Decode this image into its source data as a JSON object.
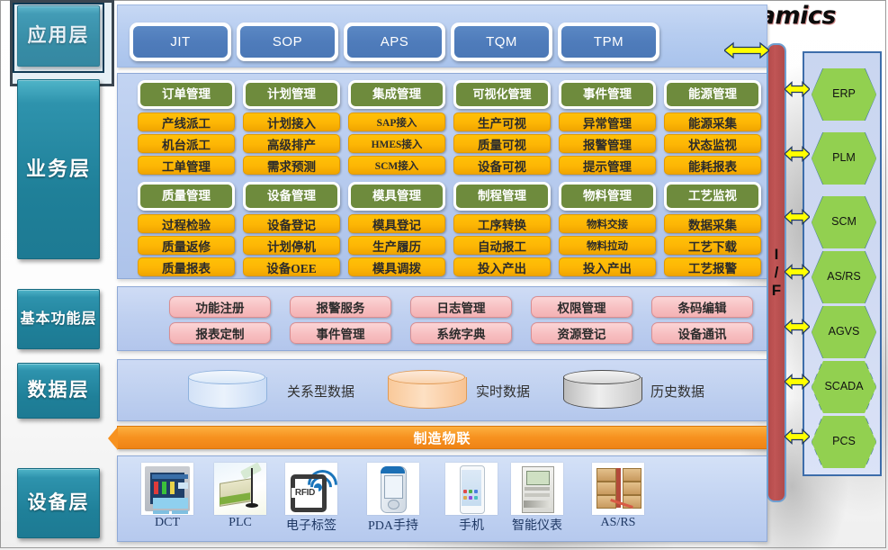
{
  "title": "Dynamics",
  "layers": [
    {
      "id": "application",
      "label": "应用层",
      "selected": true
    },
    {
      "id": "business",
      "label": "业务层",
      "selected": false
    },
    {
      "id": "basic-function",
      "label": "基本\n功能层",
      "label_line1": "基本",
      "label_line2": "功能层",
      "selected": false
    },
    {
      "id": "data",
      "label": "数据层",
      "selected": false
    },
    {
      "id": "device",
      "label": "设备层",
      "selected": false
    }
  ],
  "application_layer": {
    "chips": [
      "JIT",
      "SOP",
      "APS",
      "TQM",
      "TPM"
    ]
  },
  "business_layer": {
    "columns": [
      {
        "groups": [
          {
            "head": "订单管理",
            "items": [
              "产线派工",
              "机台派工",
              "工单管理"
            ]
          },
          {
            "head": "质量管理",
            "items": [
              "过程检验",
              "质量返修",
              "质量报表"
            ]
          }
        ]
      },
      {
        "groups": [
          {
            "head": "计划管理",
            "items": [
              "计划接入",
              "高级排产",
              "需求预测"
            ]
          },
          {
            "head": "设备管理",
            "items": [
              "设备登记",
              "计划停机",
              "设备OEE"
            ]
          }
        ]
      },
      {
        "groups": [
          {
            "head": "集成管理",
            "items": [
              "SAP接入",
              "HMES接入",
              "SCM接入"
            ]
          },
          {
            "head": "模具管理",
            "items": [
              "模具登记",
              "生产履历",
              "模具调拨"
            ]
          }
        ]
      },
      {
        "groups": [
          {
            "head": "可视化管理",
            "items": [
              "生产可视",
              "质量可视",
              "设备可视"
            ]
          },
          {
            "head": "制程管理",
            "items": [
              "工序转换",
              "自动报工",
              "投入产出"
            ]
          }
        ]
      },
      {
        "groups": [
          {
            "head": "事件管理",
            "items": [
              "异常管理",
              "报警管理",
              "提示管理"
            ]
          },
          {
            "head": "物料管理",
            "items": [
              "物料交接",
              "物料拉动",
              "投入产出"
            ]
          }
        ]
      },
      {
        "groups": [
          {
            "head": "能源管理",
            "items": [
              "能源采集",
              "状态监视",
              "能耗报表"
            ]
          },
          {
            "head": "工艺监视",
            "items": [
              "数据采集",
              "工艺下载",
              "工艺报警"
            ]
          }
        ]
      }
    ]
  },
  "basic_function_layer": {
    "row1": [
      "功能注册",
      "报警服务",
      "日志管理",
      "权限管理",
      "条码编辑"
    ],
    "row2": [
      "报表定制",
      "事件管理",
      "系统字典",
      "资源登记",
      "设备通讯"
    ]
  },
  "data_layer": {
    "stores": [
      {
        "label": "关系型数据",
        "color": "#dae8f8",
        "style": "blue"
      },
      {
        "label": "实时数据",
        "color": "#f9d3ae",
        "style": "orange"
      },
      {
        "label": "历史数据",
        "color": "#d8d8d8",
        "style": "grey"
      }
    ]
  },
  "iot_bar": {
    "label": "制造物联",
    "color": "#f79220"
  },
  "device_layer": {
    "devices": [
      {
        "label": "DCT",
        "icon": "hmi-panel-icon"
      },
      {
        "label": "PLC",
        "icon": "plc-module-icon"
      },
      {
        "label": "电子标签",
        "icon": "rfid-tag-icon"
      },
      {
        "label": "PDA手持",
        "icon": "pda-handheld-icon"
      },
      {
        "label": "手机",
        "icon": "mobile-phone-icon"
      },
      {
        "label": "智能仪表",
        "icon": "smart-meter-icon"
      },
      {
        "label": "AS/RS",
        "icon": "asrs-rack-icon"
      }
    ]
  },
  "interface_bar": {
    "label_lines": [
      "I",
      "/",
      "F"
    ],
    "color": "#b44b4b"
  },
  "external_systems": {
    "items": [
      {
        "label": "ERP",
        "dashed": false
      },
      {
        "label": "PLM",
        "dashed": false
      },
      {
        "label": "SCM",
        "dashed": false
      },
      {
        "label": "AS/RS",
        "dashed": false
      },
      {
        "label": "AGVS",
        "dashed": false
      },
      {
        "label": "SCADA",
        "label_line1": "SCAD",
        "label_line2": "A",
        "dashed": true
      },
      {
        "label": "PCS",
        "dashed": true
      }
    ],
    "hex_color": "#92d050",
    "border_color": "#3d6daa"
  }
}
